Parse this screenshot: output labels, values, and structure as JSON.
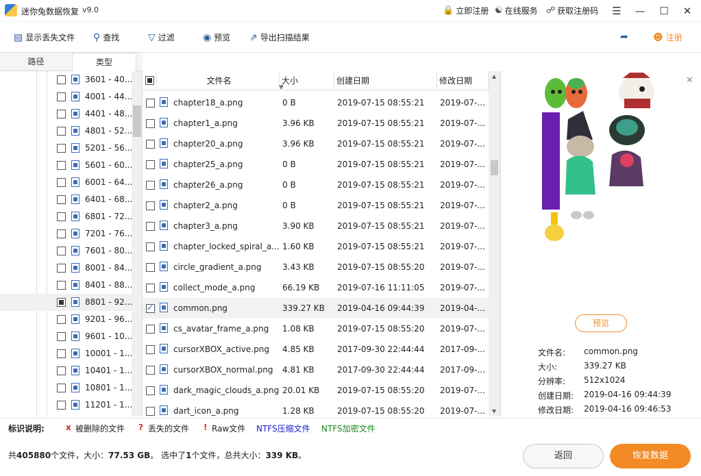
{
  "app": {
    "title": "迷你兔数据恢复",
    "version": "v9.0"
  },
  "titlebar": {
    "register_link": "立即注册",
    "online_service": "在线服务",
    "get_code": "获取注册码",
    "menu_icon": "menu-icon",
    "minimize_icon": "minimize-icon",
    "maximize_icon": "maximize-icon",
    "close_icon": "close-icon"
  },
  "toolbar": {
    "show_lost": "显示丢失文件",
    "find": "查找",
    "filter": "过滤",
    "preview": "预览",
    "export": "导出扫描结果",
    "register": "注册"
  },
  "tabs": {
    "path": "路径",
    "type": "类型"
  },
  "tree": {
    "items": [
      {
        "label": "3601 - 40...",
        "state": "none"
      },
      {
        "label": "4001 - 44...",
        "state": "none"
      },
      {
        "label": "4401 - 48...",
        "state": "none"
      },
      {
        "label": "4801 - 52...",
        "state": "none"
      },
      {
        "label": "5201 - 56...",
        "state": "none"
      },
      {
        "label": "5601 - 60...",
        "state": "none"
      },
      {
        "label": "6001 - 64...",
        "state": "none"
      },
      {
        "label": "6401 - 68...",
        "state": "none"
      },
      {
        "label": "6801 - 72...",
        "state": "none"
      },
      {
        "label": "7201 - 76...",
        "state": "none"
      },
      {
        "label": "7601 - 80...",
        "state": "none"
      },
      {
        "label": "8001 - 84...",
        "state": "none"
      },
      {
        "label": "8401 - 88...",
        "state": "none"
      },
      {
        "label": "8801 - 92...",
        "state": "partial"
      },
      {
        "label": "9201 - 96...",
        "state": "none"
      },
      {
        "label": "9601 - 10...",
        "state": "none"
      },
      {
        "label": "10001 - 1...",
        "state": "none"
      },
      {
        "label": "10401 - 1...",
        "state": "none"
      },
      {
        "label": "10801 - 1...",
        "state": "none"
      },
      {
        "label": "11201 - 1...",
        "state": "none"
      }
    ]
  },
  "list": {
    "headers": {
      "name": "文件名",
      "size": "大小",
      "created": "创建日期",
      "modified": "修改日期"
    },
    "rows": [
      {
        "name": "chapter18_a.png",
        "size": "0 B",
        "created": "2019-07-15 08:55:21",
        "modified": "2019-07-...",
        "checked": false
      },
      {
        "name": "chapter1_a.png",
        "size": "3.96 KB",
        "created": "2019-07-15 08:55:21",
        "modified": "2019-07-...",
        "checked": false
      },
      {
        "name": "chapter20_a.png",
        "size": "3.96 KB",
        "created": "2019-07-15 08:55:21",
        "modified": "2019-07-...",
        "checked": false
      },
      {
        "name": "chapter25_a.png",
        "size": "0 B",
        "created": "2019-07-15 08:55:21",
        "modified": "2019-07-...",
        "checked": false
      },
      {
        "name": "chapter26_a.png",
        "size": "0 B",
        "created": "2019-07-15 08:55:21",
        "modified": "2019-07-...",
        "checked": false
      },
      {
        "name": "chapter2_a.png",
        "size": "0 B",
        "created": "2019-07-15 08:55:21",
        "modified": "2019-07-...",
        "checked": false
      },
      {
        "name": "chapter3_a.png",
        "size": "3.90 KB",
        "created": "2019-07-15 08:55:21",
        "modified": "2019-07-...",
        "checked": false
      },
      {
        "name": "chapter_locked_spiral_a....",
        "size": "1.60 KB",
        "created": "2019-07-15 08:55:21",
        "modified": "2019-07-...",
        "checked": false
      },
      {
        "name": "circle_gradient_a.png",
        "size": "3.43 KB",
        "created": "2019-07-15 08:55:20",
        "modified": "2019-07-...",
        "checked": false
      },
      {
        "name": "collect_mode_a.png",
        "size": "66.19 KB",
        "created": "2019-07-16 11:11:05",
        "modified": "2019-07-...",
        "checked": false
      },
      {
        "name": "common.png",
        "size": "339.27 KB",
        "created": "2019-04-16 09:44:39",
        "modified": "2019-04-...",
        "checked": true
      },
      {
        "name": "cs_avatar_frame_a.png",
        "size": "1.08 KB",
        "created": "2019-07-15 08:55:20",
        "modified": "2019-07-...",
        "checked": false
      },
      {
        "name": "cursorXBOX_active.png",
        "size": "4.85 KB",
        "created": "2017-09-30 22:44:44",
        "modified": "2017-09-...",
        "checked": false
      },
      {
        "name": "cursorXBOX_normal.png",
        "size": "4.81 KB",
        "created": "2017-09-30 22:44:44",
        "modified": "2017-09-...",
        "checked": false
      },
      {
        "name": "dark_magic_clouds_a.png",
        "size": "20.01 KB",
        "created": "2019-07-15 08:55:20",
        "modified": "2019-07-...",
        "checked": false
      },
      {
        "name": "dart_icon_a.png",
        "size": "1.28 KB",
        "created": "2019-07-15 08:55:20",
        "modified": "2019-07-...",
        "checked": false
      }
    ]
  },
  "preview": {
    "button": "预览",
    "info": [
      {
        "label": "文件名:",
        "value": "common.png"
      },
      {
        "label": "大小:",
        "value": "339.27 KB"
      },
      {
        "label": "分辨率:",
        "value": "512x1024"
      },
      {
        "label": "创建日期:",
        "value": "2019-04-16 09:44:39"
      },
      {
        "label": "修改日期:",
        "value": "2019-04-16 09:46:53"
      }
    ]
  },
  "legend": {
    "title": "标识说明:",
    "deleted_mark": "x",
    "deleted": "被删除的文件",
    "lost_mark": "?",
    "lost": "丢失的文件",
    "raw_mark": "!",
    "raw": "Raw文件",
    "ntfs_compressed": "NTFS压缩文件",
    "ntfs_encrypted": "NTFS加密文件",
    "colors": {
      "mark": "#e02020",
      "compressed": "#1a1ad6",
      "encrypted": "#1a8a1a"
    }
  },
  "status": {
    "prefix": "共",
    "total_files": "405880",
    "files_size_label": "个文件，大小：",
    "total_size": "77.53 GB",
    "selected_label": "。 选中了",
    "selected_count": "1",
    "selected_size_label": "个文件，总共大小：",
    "selected_size": "339 KB",
    "suffix": "。"
  },
  "buttons": {
    "back": "返回",
    "recover": "恢复数据"
  },
  "colors": {
    "accent": "#f38a26",
    "icon_blue": "#2a5d9f"
  }
}
